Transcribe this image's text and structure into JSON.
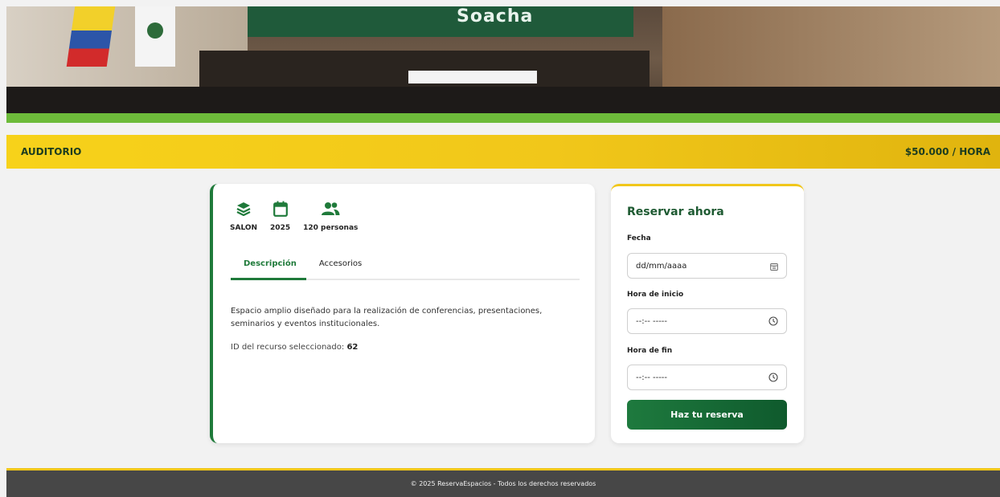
{
  "resource": {
    "name": "AUDITORIO",
    "price": "$50.000 / HORA",
    "hero_banner_text": "Soacha"
  },
  "stats": [
    {
      "icon": "layers-icon",
      "label": "SALON"
    },
    {
      "icon": "calendar-icon",
      "label": "2025"
    },
    {
      "icon": "users-icon",
      "label": "120 personas"
    }
  ],
  "tabs": {
    "description": "Descripción",
    "accessories": "Accesorios"
  },
  "description": "Espacio amplio diseñado para la realización de conferencias, presentaciones, seminarios y eventos institucionales.",
  "resource_id": {
    "label": "ID del recurso seleccionado:",
    "value": "62"
  },
  "booking": {
    "title": "Reservar ahora",
    "date_label": "Fecha",
    "date_value": "dd/mm/aaaa",
    "start_label": "Hora de inicio",
    "start_value": "--:-- -----",
    "end_label": "Hora de fin",
    "end_value": "--:-- -----",
    "submit": "Haz tu reserva"
  },
  "footer": "© 2025 ReservaEspacios - Todos los derechos reservados",
  "colors": {
    "primary_green": "#1f7a3a",
    "accent_yellow": "#f1c71a",
    "footer_gray": "#474747"
  }
}
